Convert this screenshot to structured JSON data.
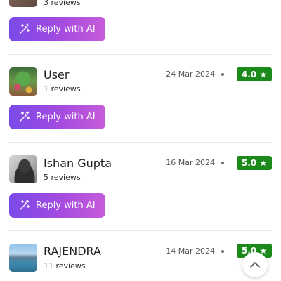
{
  "actions": {
    "reply_label": "Reply with AI"
  },
  "reviews": [
    {
      "name": "",
      "reviews_count": "3 reviews",
      "date": "",
      "rating": ""
    },
    {
      "name": "User",
      "reviews_count": "1 reviews",
      "date": "24 Mar 2024",
      "rating": "4.0 ★"
    },
    {
      "name": "Ishan Gupta",
      "reviews_count": "5 reviews",
      "date": "16 Mar 2024",
      "rating": "5.0 ★"
    },
    {
      "name": "RAJENDRA",
      "reviews_count": "11 reviews",
      "date": "14 Mar 2024",
      "rating": "5.0 ★"
    }
  ],
  "colors": {
    "rating_badge": "#1b8a1b",
    "reply_gradient_start": "#7a4ae8",
    "reply_gradient_end": "#c55bd9"
  },
  "icons": {
    "reply": "magic-wand-icon",
    "scroll": "chevron-up-icon"
  }
}
